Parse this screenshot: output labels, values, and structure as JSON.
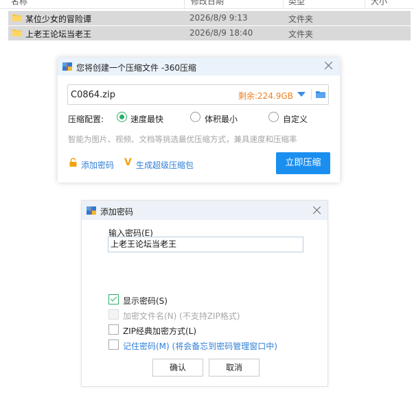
{
  "explorer": {
    "columns": [
      "名称",
      "修改日期",
      "类型",
      "大小"
    ],
    "rows": [
      {
        "name": "某位少女的冒险谭",
        "modified": "2026/8/9 9:13",
        "type": "文件夹"
      },
      {
        "name": "上老王论坛当老王",
        "modified": "2026/8/9 18:40",
        "type": "文件夹"
      }
    ]
  },
  "compress_dialog": {
    "title": "您将创建一个压缩文件 -360压缩",
    "filename": "C0864.zip",
    "remaining": "剩余:224.9GB",
    "config_label": "压缩配置:",
    "options": [
      {
        "label": "速度最快",
        "selected": true
      },
      {
        "label": "体积最小",
        "selected": false
      },
      {
        "label": "自定义",
        "selected": false
      }
    ],
    "hint": "智能为图片、视频、文档等挑选最优压缩方式，兼具速度和压缩率",
    "add_password_link": "添加密码",
    "super_package_link": "生成超级压缩包",
    "compress_button": "立即压缩"
  },
  "password_dialog": {
    "title": "添加密码",
    "input_label": "输入密码(E)",
    "password_value": "上老王论坛当老王",
    "checkboxes": [
      {
        "label": "显示密码(S)",
        "checked": true,
        "disabled": false
      },
      {
        "label": "加密文件名(N) (不支持ZIP格式)",
        "checked": false,
        "disabled": true
      },
      {
        "label": "ZIP经典加密方式(L)",
        "checked": false,
        "disabled": false
      },
      {
        "label": "记住密码(M) (将会备忘到密码管理窗口中)",
        "checked": false,
        "disabled": false
      }
    ],
    "confirm_button": "确认",
    "cancel_button": "取消"
  },
  "colors": {
    "accent_blue": "#1b8ff0",
    "link_blue": "#2f7fd6",
    "orange": "#ef7f20",
    "green": "#2bae66"
  }
}
